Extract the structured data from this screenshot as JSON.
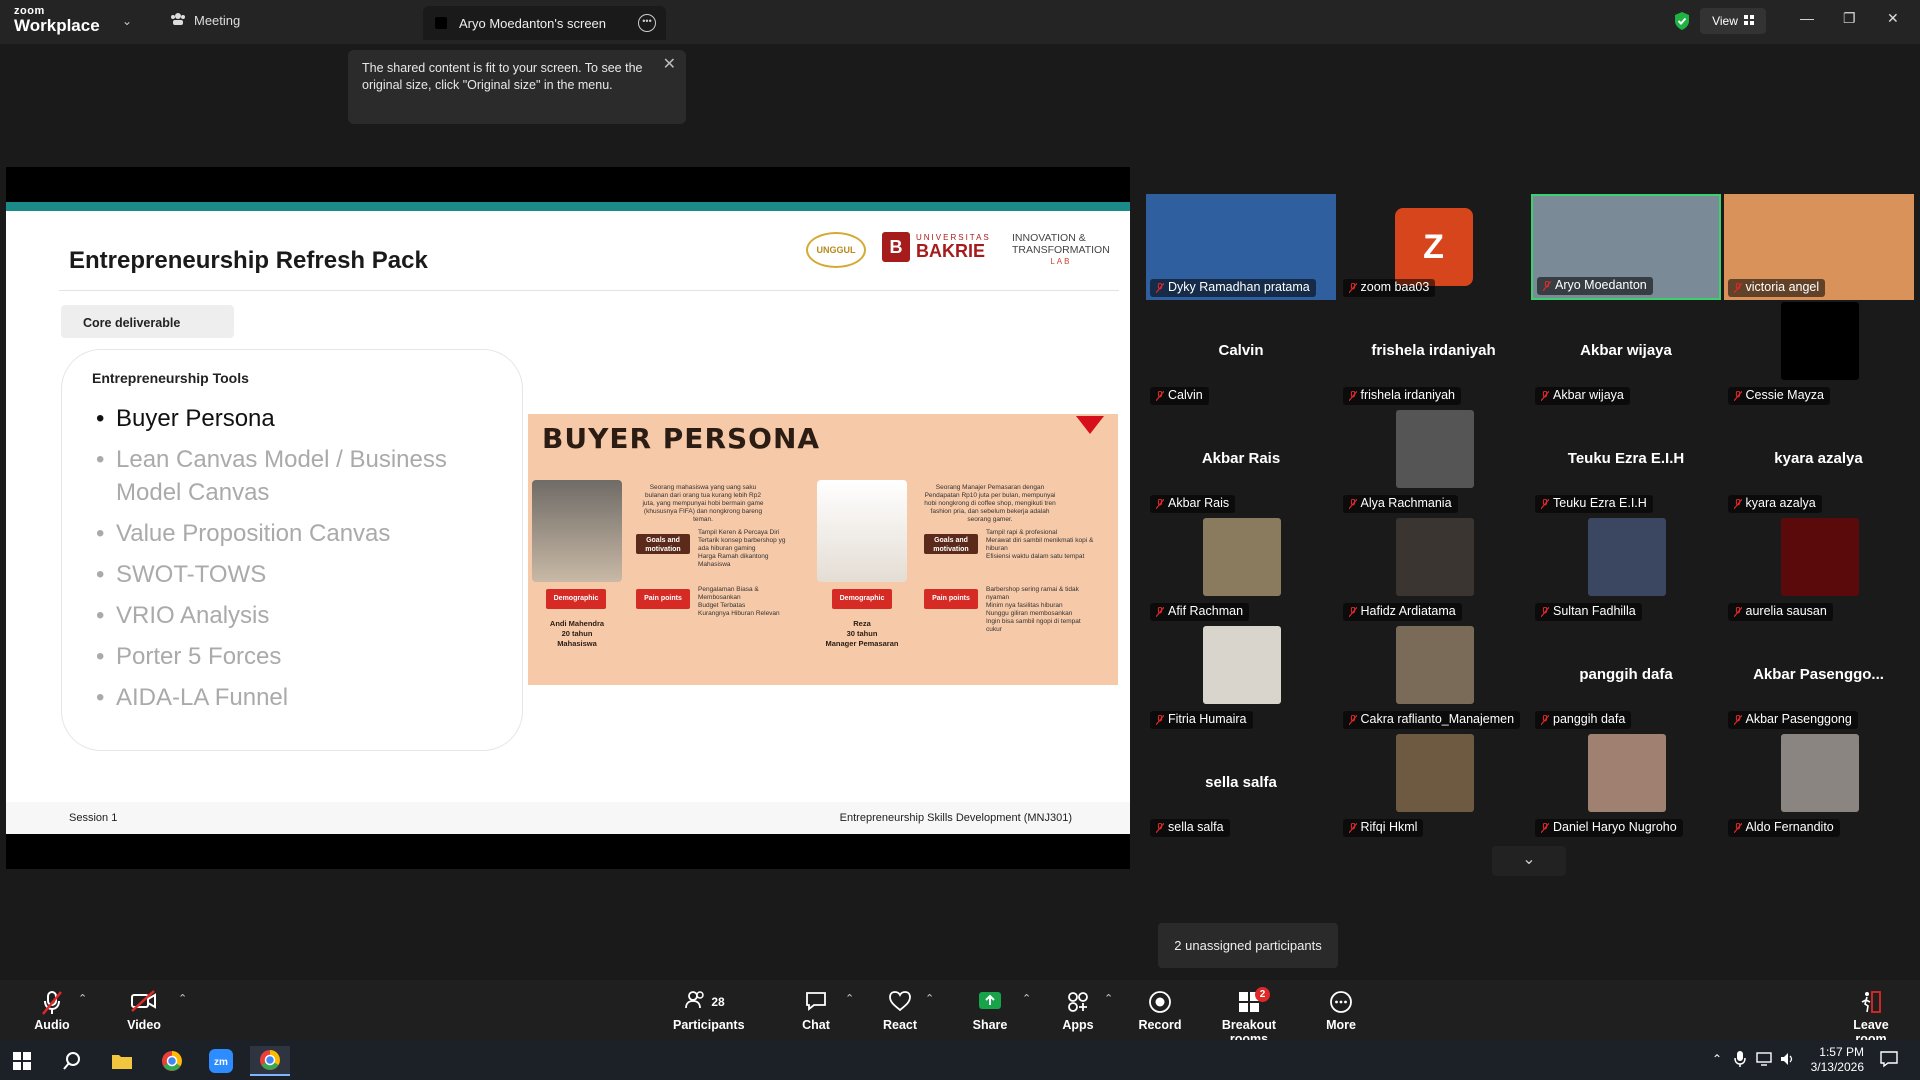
{
  "titlebar": {
    "logo_line1": "zoom",
    "logo_line2": "Workplace",
    "meeting_label": "Meeting",
    "screen_tab_label": "Aryo Moedanton's screen",
    "view_label": "View"
  },
  "tooltip": {
    "text": "The shared content is fit to your screen. To see the original size, click \"Original size\" in the menu."
  },
  "slide": {
    "title": "Entrepreneurship Refresh Pack",
    "badge_text": "UNGGUL",
    "bakrie_top": "UNIVERSITAS",
    "bakrie_name": "BAKRIE",
    "itl_line1": "INNOVATION &",
    "itl_line2": "TRANSFORMATION",
    "itl_line3": "LAB",
    "core_label": "Core deliverable",
    "tools_heading": "Entrepreneurship Tools",
    "tools": [
      "Buyer Persona",
      "Lean Canvas Model / Business Model Canvas",
      "Value Proposition Canvas",
      "SWOT-TOWS",
      "VRIO Analysis",
      "Porter 5 Forces",
      "AIDA-LA Funnel"
    ],
    "footer_left": "Session 1",
    "footer_right": "Entrepreneurship Skills Development (MNJ301)",
    "persona": {
      "title": "BUYER PERSONA",
      "p1_desc": "Seorang mahasiswa yang uang saku bulanan dari orang tua kurang lebih Rp2 juta, yang mempunyai hobi bermain game (khususnya FIFA) dan nongkrong bareng teman.",
      "p1_goals": [
        "Tampil Keren & Percaya Diri",
        "Tertarik konsep barbershop yg ada hiburan gaming",
        "Harga Ramah dikantong Mahasiswa"
      ],
      "p1_pains": [
        "Pengalaman Biasa & Membosankan",
        "Budget Terbatas",
        "Kurangnya Hiburan Relevan"
      ],
      "p1_name": "Andi Mahendra",
      "p1_age": "20 tahun",
      "p1_role": "Mahasiswa",
      "p2_desc": "Seorang Manajer Pemasaran dengan Pendapatan Rp10 juta per bulan, mempunyai hobi nongkrong di coffee shop, mengikuti tren fashion pria, dan sebelum bekerja adalah seorang gamer.",
      "p2_goals": [
        "Tampil rapi & profesional",
        "Merawat diri sambil menikmati kopi & hiburan",
        "Efisiensi waktu dalam satu tempat"
      ],
      "p2_pains": [
        "Barbershop sering ramai & tidak nyaman",
        "Minim nya fasilitas hiburan",
        "Nunggu giliran membosankan",
        "Ingin bisa sambil ngopi di tempat cukur"
      ],
      "p2_name": "Reza",
      "p2_age": "30 tahun",
      "p2_role": "Manager Pemasaran",
      "goals_label": "Goals and motivation",
      "pain_label": "Pain points",
      "demo_label": "Demographic"
    }
  },
  "participants": [
    {
      "name": "Dyky Ramadhan pratama",
      "big": "",
      "video": "#2f5f9e"
    },
    {
      "name": "zoom baa03",
      "big": "",
      "avatar": "Z",
      "avatar_color": "#d6451c"
    },
    {
      "name": "Aryo Moedanton",
      "big": "",
      "video": "#7a8a96",
      "active": true
    },
    {
      "name": "victoria angel",
      "big": "",
      "video": "#d8925a"
    },
    {
      "name": "Calvin",
      "big": "Calvin"
    },
    {
      "name": "frishela irdaniyah",
      "big": "frishela irdaniyah"
    },
    {
      "name": "Akbar wijaya",
      "big": "Akbar wijaya"
    },
    {
      "name": "Cessie Mayza",
      "big": "",
      "video": "#000000"
    },
    {
      "name": "Akbar Rais",
      "big": "Akbar Rais"
    },
    {
      "name": "Alya Rachmania",
      "big": "",
      "video": "#555555"
    },
    {
      "name": "Teuku Ezra E.I.H",
      "big": "Teuku Ezra E.I.H"
    },
    {
      "name": "kyara azalya",
      "big": "kyara azalya"
    },
    {
      "name": "Afif Rachman",
      "big": "",
      "video": "#8a7a5e"
    },
    {
      "name": "Hafidz Ardiatama",
      "big": "",
      "video": "#3a3530"
    },
    {
      "name": "Sultan Fadhilla",
      "big": "",
      "video": "#3b4660"
    },
    {
      "name": "aurelia sausan",
      "big": "",
      "video": "#5a0a0a"
    },
    {
      "name": "Fitria Humaira",
      "big": "",
      "video": "#d9d4cc"
    },
    {
      "name": "Cakra raflianto_Manajemen",
      "big": "",
      "video": "#7a6a58"
    },
    {
      "name": "panggih dafa",
      "big": "panggih dafa"
    },
    {
      "name": "Akbar Pasenggong",
      "big": "Akbar  Pasenggo..."
    },
    {
      "name": "sella salfa",
      "big": "sella salfa"
    },
    {
      "name": "Rifqi Hkml",
      "big": "",
      "video": "#6e5a40"
    },
    {
      "name": "Daniel Haryo Nugroho",
      "big": "",
      "video": "#a08070"
    },
    {
      "name": "Aldo Fernandito",
      "big": "",
      "video": "#8a8580"
    }
  ],
  "unassigned_label": "2 unassigned participants",
  "toolbar": {
    "audio": "Audio",
    "video": "Video",
    "participants": "Participants",
    "participants_count": "28",
    "chat": "Chat",
    "react": "React",
    "share": "Share",
    "apps": "Apps",
    "record": "Record",
    "breakout": "Breakout rooms",
    "breakout_badge": "2",
    "more": "More",
    "leave": "Leave room"
  },
  "taskbar": {
    "time": "1:57 PM",
    "date": "3/13/2026"
  },
  "colors": {
    "accent_teal": "#1d8a8a",
    "mic_muted": "#e02828",
    "share_green": "#16a34a",
    "active_speaker": "#3ecf6f"
  }
}
